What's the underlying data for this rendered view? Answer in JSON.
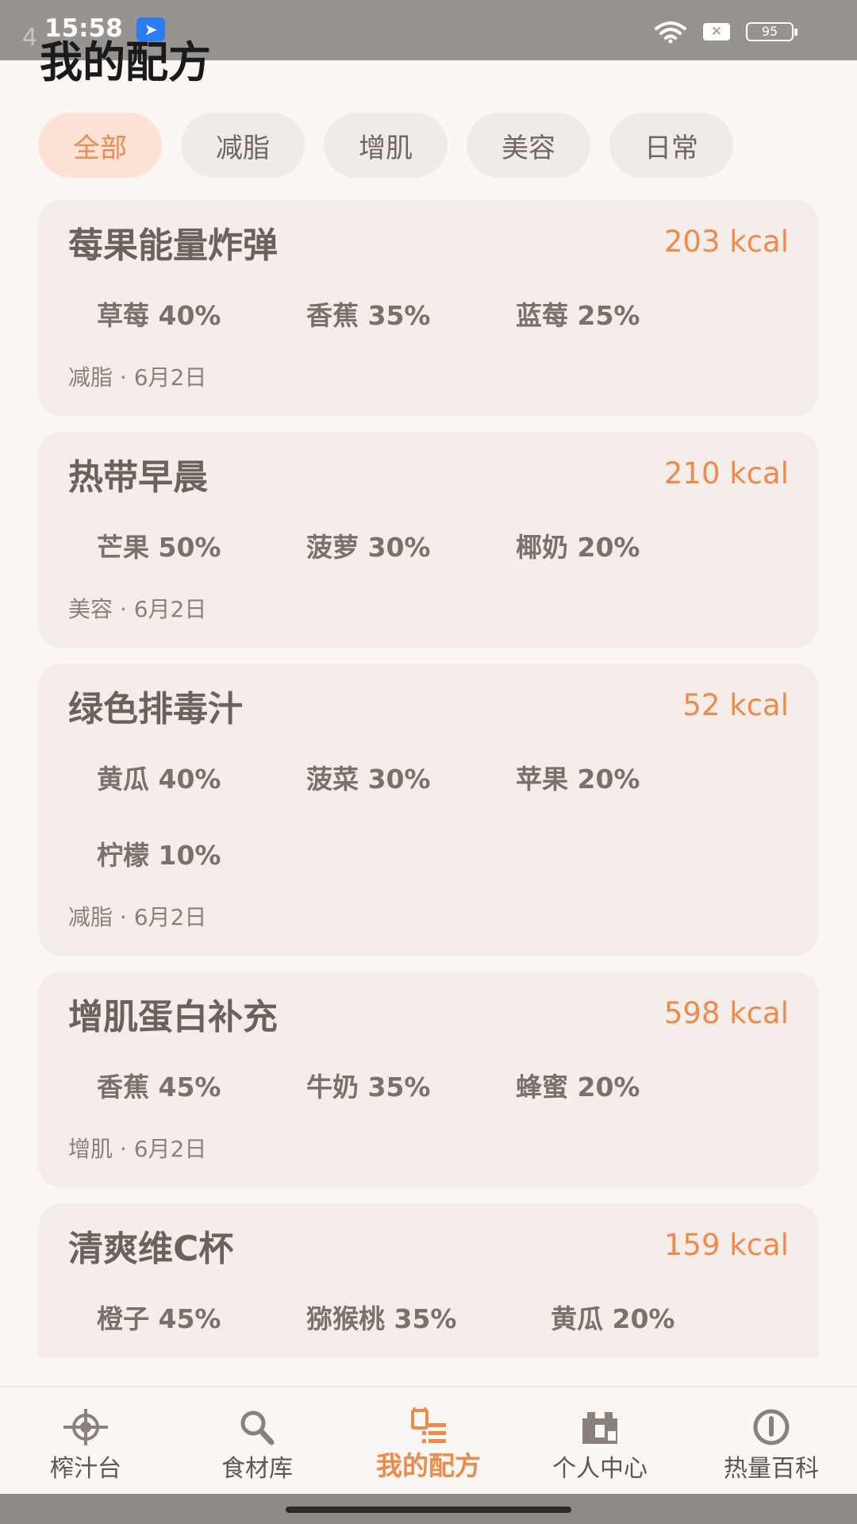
{
  "status": {
    "time": "15:58",
    "battery": "95"
  },
  "page": {
    "ghost": "4",
    "title": "我的配方"
  },
  "filters": [
    {
      "label": "全部",
      "active": true
    },
    {
      "label": "减脂",
      "active": false
    },
    {
      "label": "增肌",
      "active": false
    },
    {
      "label": "美容",
      "active": false
    },
    {
      "label": "日常",
      "active": false
    }
  ],
  "recipes": [
    {
      "name": "莓果能量炸弹",
      "kcal": "203 kcal",
      "ingredients": [
        "草莓 40%",
        "香蕉 35%",
        "蓝莓 25%"
      ],
      "meta": "减脂 · 6月2日"
    },
    {
      "name": "热带早晨",
      "kcal": "210 kcal",
      "ingredients": [
        "芒果 50%",
        "菠萝 30%",
        "椰奶 20%"
      ],
      "meta": "美容 · 6月2日"
    },
    {
      "name": "绿色排毒汁",
      "kcal": "52 kcal",
      "ingredients": [
        "黄瓜 40%",
        "菠菜 30%",
        "苹果 20%",
        "柠檬 10%"
      ],
      "meta": "减脂 · 6月2日"
    },
    {
      "name": "增肌蛋白补充",
      "kcal": "598 kcal",
      "ingredients": [
        "香蕉 45%",
        "牛奶 35%",
        "蜂蜜 20%"
      ],
      "meta": "增肌 · 6月2日"
    },
    {
      "name": "清爽维C杯",
      "kcal": "159 kcal",
      "ingredients": [
        "橙子 45%",
        "猕猴桃 35%",
        "黄瓜 20%"
      ],
      "meta": ""
    }
  ],
  "nav": [
    {
      "label": "榨汁台",
      "icon": "target-icon",
      "active": false
    },
    {
      "label": "食材库",
      "icon": "search-icon",
      "active": false
    },
    {
      "label": "我的配方",
      "icon": "recipe-list-icon",
      "active": true
    },
    {
      "label": "个人中心",
      "icon": "person-icon",
      "active": false
    },
    {
      "label": "热量百科",
      "icon": "info-icon",
      "active": false
    }
  ],
  "colors": {
    "accent": "#f08a4b",
    "card": "#f4ede9",
    "background": "#fbf7f4"
  }
}
